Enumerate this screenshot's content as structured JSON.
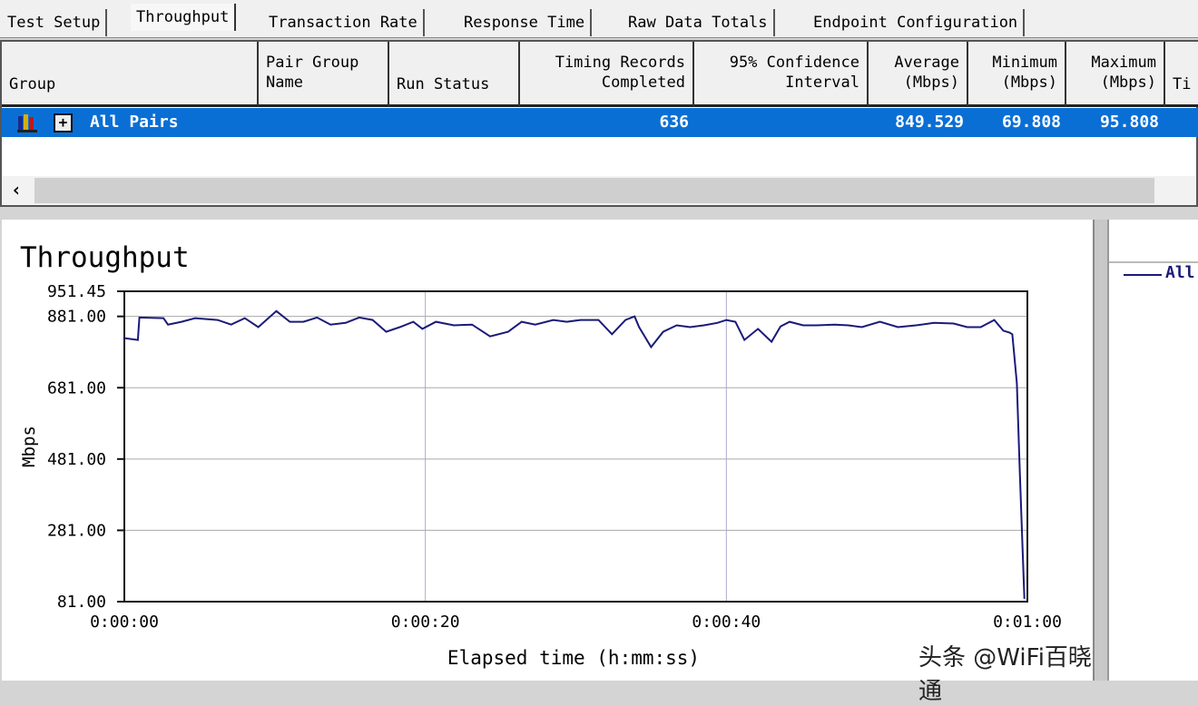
{
  "tabs": [
    "Test Setup",
    "Throughput",
    "Transaction Rate",
    "Response Time",
    "Raw Data Totals",
    "Endpoint Configuration"
  ],
  "active_tab": "Throughput",
  "columns": {
    "group": "Group",
    "pair_group_name": [
      "Pair Group",
      "Name"
    ],
    "run_status": "Run Status",
    "timing": [
      "Timing Records",
      "Completed"
    ],
    "confidence": [
      "95% Confidence",
      "Interval"
    ],
    "average": [
      "Average",
      "(Mbps)"
    ],
    "minimum": [
      "Minimum",
      "(Mbps)"
    ],
    "maximum": [
      "Maximum",
      "(Mbps)"
    ],
    "truncated": "Ti"
  },
  "rows": [
    {
      "group": "All Pairs",
      "timing_records": "636",
      "average": "849.529",
      "minimum": "69.808",
      "maximum": "95.808"
    }
  ],
  "legend": {
    "series": "All"
  },
  "watermark": "头条 @WiFi百晓通",
  "colors": {
    "selection": "#0a6fd4",
    "series": "#1a1a7a"
  },
  "chart_data": {
    "type": "line",
    "title": "Throughput",
    "xlabel": "Elapsed time (h:mm:ss)",
    "ylabel": "Mbps",
    "xlim": [
      0,
      60
    ],
    "ylim": [
      81,
      951.45
    ],
    "yticks": [
      "951.45",
      "881.00",
      "681.00",
      "481.00",
      "281.00",
      "81.00"
    ],
    "ytick_values": [
      951.45,
      881,
      681,
      481,
      281,
      81
    ],
    "xticks": [
      "0:00:00",
      "0:00:20",
      "0:00:40",
      "0:01:00"
    ],
    "xtick_values": [
      0,
      20,
      40,
      60
    ],
    "grid": true,
    "legend": "right",
    "series": [
      {
        "name": "All",
        "points": [
          [
            0,
            820
          ],
          [
            0.9,
            815
          ],
          [
            1.0,
            878
          ],
          [
            2.6,
            876
          ],
          [
            2.9,
            858
          ],
          [
            3.8,
            866
          ],
          [
            4.7,
            876
          ],
          [
            6.2,
            871
          ],
          [
            7.1,
            858
          ],
          [
            8.0,
            876
          ],
          [
            8.9,
            851
          ],
          [
            10.1,
            896
          ],
          [
            11.0,
            866
          ],
          [
            11.9,
            866
          ],
          [
            12.8,
            878
          ],
          [
            13.7,
            858
          ],
          [
            14.7,
            863
          ],
          [
            15.6,
            878
          ],
          [
            16.5,
            871
          ],
          [
            17.4,
            838
          ],
          [
            18.3,
            851
          ],
          [
            19.2,
            866
          ],
          [
            19.8,
            846
          ],
          [
            20.7,
            866
          ],
          [
            21.9,
            856
          ],
          [
            23.1,
            858
          ],
          [
            24.3,
            825
          ],
          [
            25.5,
            838
          ],
          [
            26.4,
            866
          ],
          [
            27.3,
            858
          ],
          [
            28.5,
            871
          ],
          [
            29.4,
            866
          ],
          [
            30.3,
            871
          ],
          [
            31.5,
            871
          ],
          [
            32.4,
            831
          ],
          [
            33.3,
            871
          ],
          [
            33.9,
            881
          ],
          [
            34.2,
            851
          ],
          [
            35.0,
            795
          ],
          [
            35.8,
            838
          ],
          [
            36.7,
            856
          ],
          [
            37.6,
            851
          ],
          [
            38.5,
            856
          ],
          [
            39.4,
            863
          ],
          [
            40.0,
            871
          ],
          [
            40.6,
            866
          ],
          [
            41.2,
            815
          ],
          [
            42.1,
            846
          ],
          [
            43.0,
            810
          ],
          [
            43.6,
            853
          ],
          [
            44.2,
            866
          ],
          [
            45.1,
            856
          ],
          [
            46.0,
            856
          ],
          [
            47.2,
            858
          ],
          [
            48.1,
            856
          ],
          [
            49.0,
            851
          ],
          [
            50.2,
            866
          ],
          [
            51.4,
            851
          ],
          [
            52.6,
            856
          ],
          [
            53.8,
            863
          ],
          [
            55.1,
            861
          ],
          [
            56.0,
            851
          ],
          [
            56.9,
            851
          ],
          [
            57.8,
            871
          ],
          [
            58.4,
            841
          ],
          [
            58.8,
            836
          ],
          [
            59.0,
            831
          ],
          [
            59.3,
            694
          ],
          [
            59.5,
            442
          ],
          [
            59.8,
            89
          ]
        ]
      }
    ]
  }
}
